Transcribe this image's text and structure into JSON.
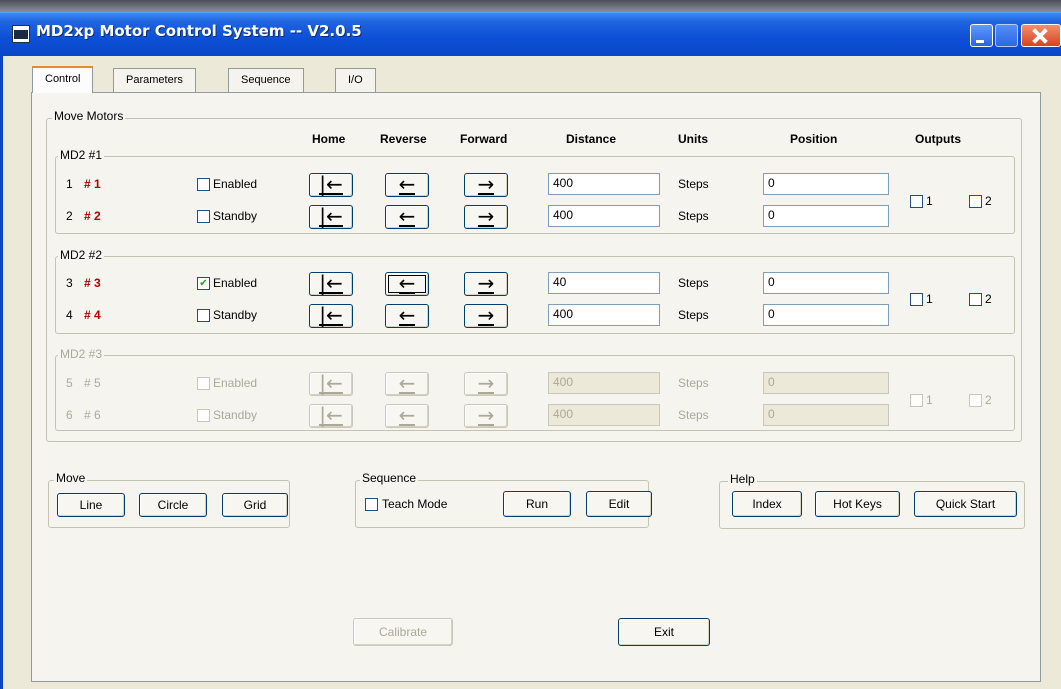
{
  "window": {
    "title": "MD2xp Motor Control System -- V2.0.5"
  },
  "tabs": [
    {
      "label": "Control",
      "active": true
    },
    {
      "label": "Parameters"
    },
    {
      "label": "Sequence"
    },
    {
      "label": "I/O"
    }
  ],
  "move_motors": {
    "title": "Move Motors",
    "columns": {
      "home": "Home",
      "reverse": "Reverse",
      "forward": "Forward",
      "distance": "Distance",
      "units": "Units",
      "position": "Position",
      "outputs": "Outputs"
    },
    "icons": {
      "home": "home-arrow-icon",
      "reverse": "left-arrow-icon",
      "forward": "right-arrow-icon"
    },
    "glyphs": {
      "home": "|←",
      "reverse": "←",
      "forward": "→"
    },
    "groups": [
      {
        "label": "MD2 #1",
        "enabled": true,
        "outputs": [
          "1",
          "2"
        ],
        "motors": [
          {
            "num": "1",
            "id": "# 1",
            "checkbox_label": "Enabled",
            "checked": false,
            "distance": "400",
            "units": "Steps",
            "position": "0"
          },
          {
            "num": "2",
            "id": "# 2",
            "checkbox_label": "Standby",
            "checked": false,
            "distance": "400",
            "units": "Steps",
            "position": "0"
          }
        ]
      },
      {
        "label": "MD2 #2",
        "enabled": true,
        "outputs": [
          "1",
          "2"
        ],
        "motors": [
          {
            "num": "3",
            "id": "# 3",
            "checkbox_label": "Enabled",
            "checked": true,
            "distance": "40",
            "units": "Steps",
            "position": "0"
          },
          {
            "num": "4",
            "id": "# 4",
            "checkbox_label": "Standby",
            "checked": false,
            "distance": "400",
            "units": "Steps",
            "position": "0"
          }
        ]
      },
      {
        "label": "MD2 #3",
        "enabled": false,
        "outputs": [
          "1",
          "2"
        ],
        "motors": [
          {
            "num": "5",
            "id": "# 5",
            "checkbox_label": "Enabled",
            "checked": false,
            "distance": "400",
            "units": "Steps",
            "position": "0"
          },
          {
            "num": "6",
            "id": "# 6",
            "checkbox_label": "Standby",
            "checked": false,
            "distance": "400",
            "units": "Steps",
            "position": "0"
          }
        ]
      }
    ]
  },
  "move_group": {
    "title": "Move",
    "buttons": [
      "Line",
      "Circle",
      "Grid"
    ]
  },
  "sequence_group": {
    "title": "Sequence",
    "teach_mode_label": "Teach Mode",
    "run_label": "Run",
    "edit_label": "Edit"
  },
  "help_group": {
    "title": "Help",
    "buttons": [
      "Index",
      "Hot Keys",
      "Quick Start"
    ]
  },
  "bottom": {
    "calibrate_label": "Calibrate",
    "exit_label": "Exit"
  },
  "colors": {
    "titlebar": "#0a46c8",
    "motor_id": "#b00000",
    "tab_highlight": "#e68b2c"
  }
}
